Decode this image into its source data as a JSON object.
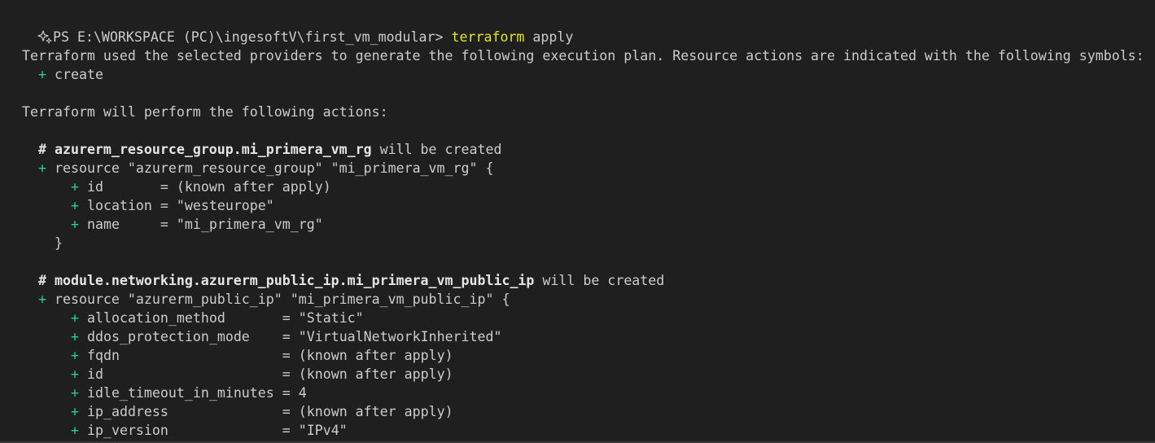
{
  "prompt": {
    "path": "PS E:\\WORKSPACE (PC)\\ingesoftV\\first_vm_modular> ",
    "command": "terraform",
    "args": " apply",
    "icon": "sparkle-icon"
  },
  "intro": {
    "line1": "Terraform used the selected providers to generate the following execution plan. Resource actions are indicated with the following symbols:",
    "symbol_plus": "+",
    "symbol_label": " create",
    "line2": "Terraform will perform the following actions:"
  },
  "resources": [
    {
      "comment_hash": "# ",
      "address": "azurerm_resource_group.mi_primera_vm_rg",
      "suffix": " will be created",
      "plus": "+",
      "declaration": " resource \"azurerm_resource_group\" \"mi_primera_vm_rg\" {",
      "attributes": [
        {
          "plus": "+",
          "text": " id       = (known after apply)"
        },
        {
          "plus": "+",
          "text": " location = \"westeurope\""
        },
        {
          "plus": "+",
          "text": " name     = \"mi_primera_vm_rg\""
        }
      ],
      "close": "}"
    },
    {
      "comment_hash": "# ",
      "address": "module.networking.azurerm_public_ip.mi_primera_vm_public_ip",
      "suffix": " will be created",
      "plus": "+",
      "declaration": " resource \"azurerm_public_ip\" \"mi_primera_vm_public_ip\" {",
      "attributes": [
        {
          "plus": "+",
          "text": " allocation_method       = \"Static\""
        },
        {
          "plus": "+",
          "text": " ddos_protection_mode    = \"VirtualNetworkInherited\""
        },
        {
          "plus": "+",
          "text": " fqdn                    = (known after apply)"
        },
        {
          "plus": "+",
          "text": " id                      = (known after apply)"
        },
        {
          "plus": "+",
          "text": " idle_timeout_in_minutes = 4"
        },
        {
          "plus": "+",
          "text": " ip_address              = (known after apply)"
        },
        {
          "plus": "+",
          "text": " ip_version              = \"IPv4\""
        }
      ]
    }
  ],
  "colors": {
    "background": "#1f1f1f",
    "text": "#cccccc",
    "command": "#e5e510",
    "plus": "#23d18b"
  }
}
